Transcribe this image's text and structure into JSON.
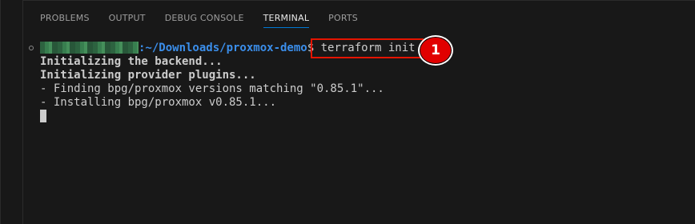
{
  "panel_tabs": [
    {
      "label": "PROBLEMS",
      "active": false
    },
    {
      "label": "OUTPUT",
      "active": false
    },
    {
      "label": "DEBUG CONSOLE",
      "active": false
    },
    {
      "label": "TERMINAL",
      "active": true
    },
    {
      "label": "PORTS",
      "active": false
    }
  ],
  "terminal": {
    "prompt_path": ":~/Downloads/proxmox-demo",
    "prompt_symbol": "$",
    "command": " terraform init",
    "output": [
      {
        "text": "Initializing the backend...",
        "bold": true
      },
      {
        "text": "Initializing provider plugins...",
        "bold": true
      },
      {
        "text": "- Finding bpg/proxmox versions matching \"0.85.1\"...",
        "bold": false
      },
      {
        "text": "- Installing bpg/proxmox v0.85.1...",
        "bold": false
      }
    ]
  },
  "annotation": {
    "badge_number": "1",
    "highlight_color": "#e51400",
    "badge_color": "#e10000"
  },
  "colors": {
    "background": "#181818",
    "path": "#3b8eea",
    "text": "#cccccc",
    "active_tab_underline": "#0078d4"
  }
}
